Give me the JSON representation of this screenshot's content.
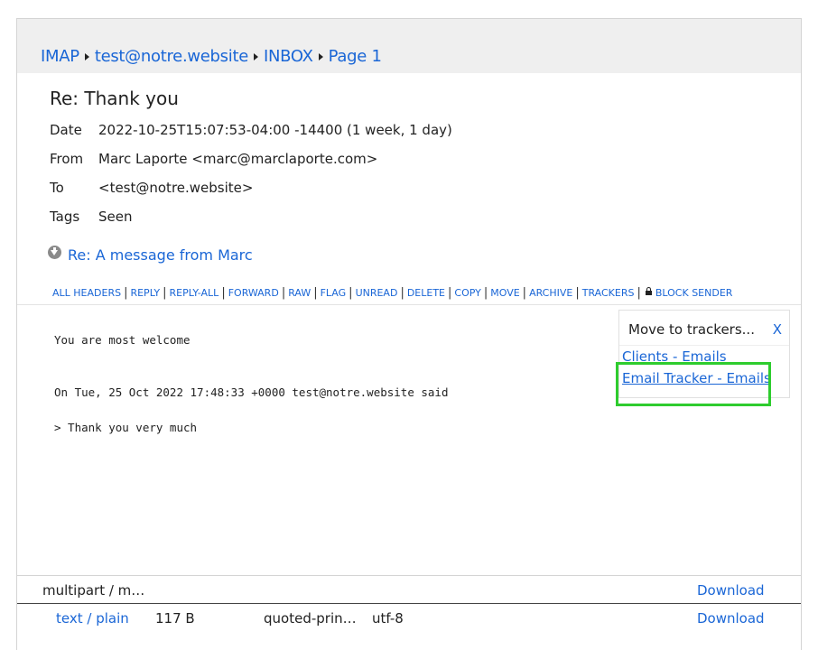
{
  "breadcrumb": {
    "items": [
      "IMAP",
      "test@notre.website",
      "INBOX",
      "Page 1"
    ]
  },
  "message": {
    "subject": "Re: Thank you",
    "headers": [
      {
        "key": "Date",
        "value": "2022-10-25T15:07:53-04:00 -14400 (1 week, 1 day)"
      },
      {
        "key": "From",
        "value": "Marc Laporte <marc@marclaporte.com>"
      },
      {
        "key": "To",
        "value": "<test@notre.website>"
      },
      {
        "key": "Tags",
        "value": "Seen"
      }
    ],
    "thread_link": "Re: A message from Marc",
    "actions": [
      "ALL HEADERS",
      "REPLY",
      "REPLY-ALL",
      "FORWARD",
      "RAW",
      "FLAG",
      "UNREAD",
      "DELETE",
      "COPY",
      "MOVE",
      "ARCHIVE",
      "TRACKERS",
      "BLOCK SENDER"
    ],
    "body_lines": [
      "You are most welcome",
      "On Tue, 25 Oct 2022 17:48:33 +0000 test@notre.website said",
      "> Thank you very much"
    ]
  },
  "move_popup": {
    "title": "Move to trackers...",
    "close_label": "X",
    "options": [
      "Clients - Emails",
      "Email Tracker - Emails"
    ]
  },
  "attachments": {
    "parent": {
      "type": "multipart / m…",
      "download_label": "Download"
    },
    "children": [
      {
        "type": "text / plain",
        "size": "117 B",
        "encoding": "quoted-prin…",
        "charset": "utf-8",
        "download_label": "Download"
      }
    ]
  },
  "colors": {
    "link": "#1a66d6",
    "highlight": "#2ecc2e",
    "topbar": "#efefef"
  }
}
